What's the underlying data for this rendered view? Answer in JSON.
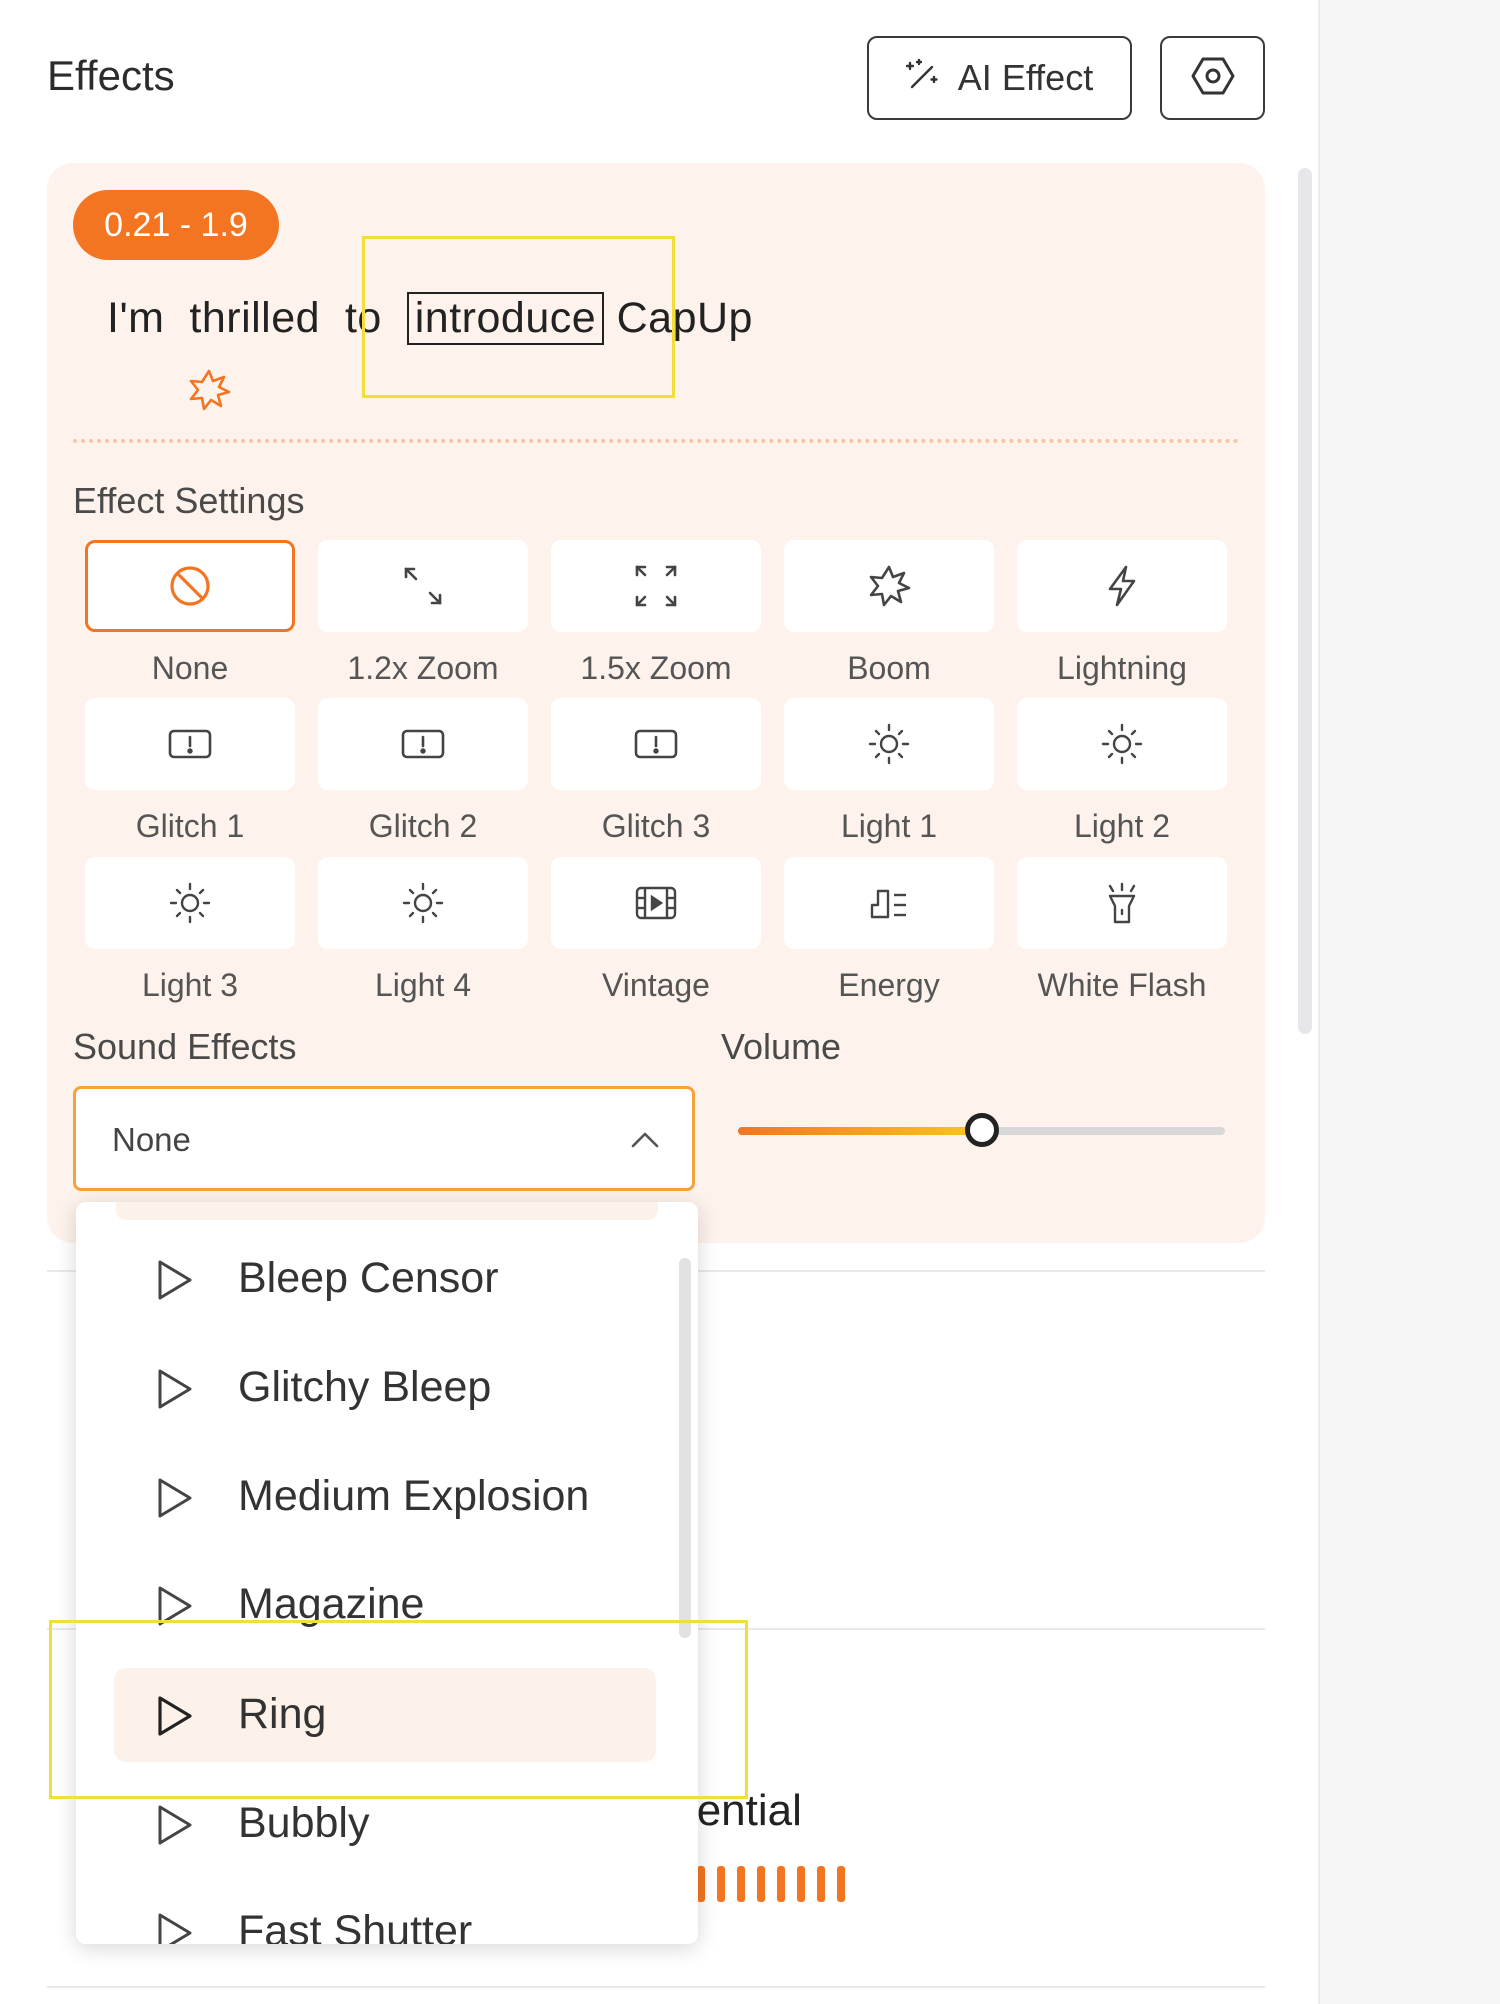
{
  "header": {
    "title": "Effects",
    "ai_effect_label": "AI Effect"
  },
  "clip": {
    "time_range": "0.21 - 1.9",
    "caption_words": [
      "I'm",
      "thrilled",
      "to",
      "introduce",
      "CapUp"
    ]
  },
  "effect_settings": {
    "label": "Effect Settings",
    "items": [
      {
        "label": "None",
        "icon": "ban-icon",
        "selected": true
      },
      {
        "label": "1.2x Zoom",
        "icon": "zoom-small-icon"
      },
      {
        "label": "1.5x Zoom",
        "icon": "zoom-large-icon"
      },
      {
        "label": "Boom",
        "icon": "burst-icon"
      },
      {
        "label": "Lightning",
        "icon": "lightning-icon"
      },
      {
        "label": "Glitch 1",
        "icon": "glitch-icon"
      },
      {
        "label": "Glitch 2",
        "icon": "glitch-icon"
      },
      {
        "label": "Glitch 3",
        "icon": "glitch-icon"
      },
      {
        "label": "Light 1",
        "icon": "sun-icon"
      },
      {
        "label": "Light 2",
        "icon": "sun-icon"
      },
      {
        "label": "Light 3",
        "icon": "sun-icon"
      },
      {
        "label": "Light 4",
        "icon": "sun-icon"
      },
      {
        "label": "Vintage",
        "icon": "film-icon"
      },
      {
        "label": "Energy",
        "icon": "energy-icon"
      },
      {
        "label": "White Flash",
        "icon": "flashlight-icon"
      }
    ]
  },
  "sound_effects": {
    "label": "Sound Effects",
    "selected": "None",
    "options": [
      "Bleep Censor",
      "Glitchy Bleep",
      "Medium Explosion",
      "Magazine",
      "Ring",
      "Bubbly",
      "Fast Shutter"
    ],
    "highlighted": "Ring"
  },
  "volume": {
    "label": "Volume",
    "level": 0.5
  },
  "background": {
    "partial_text": "otential"
  },
  "colors": {
    "accent": "#f47521",
    "card_bg": "#fef3ec",
    "highlight": "#f1de3a"
  }
}
